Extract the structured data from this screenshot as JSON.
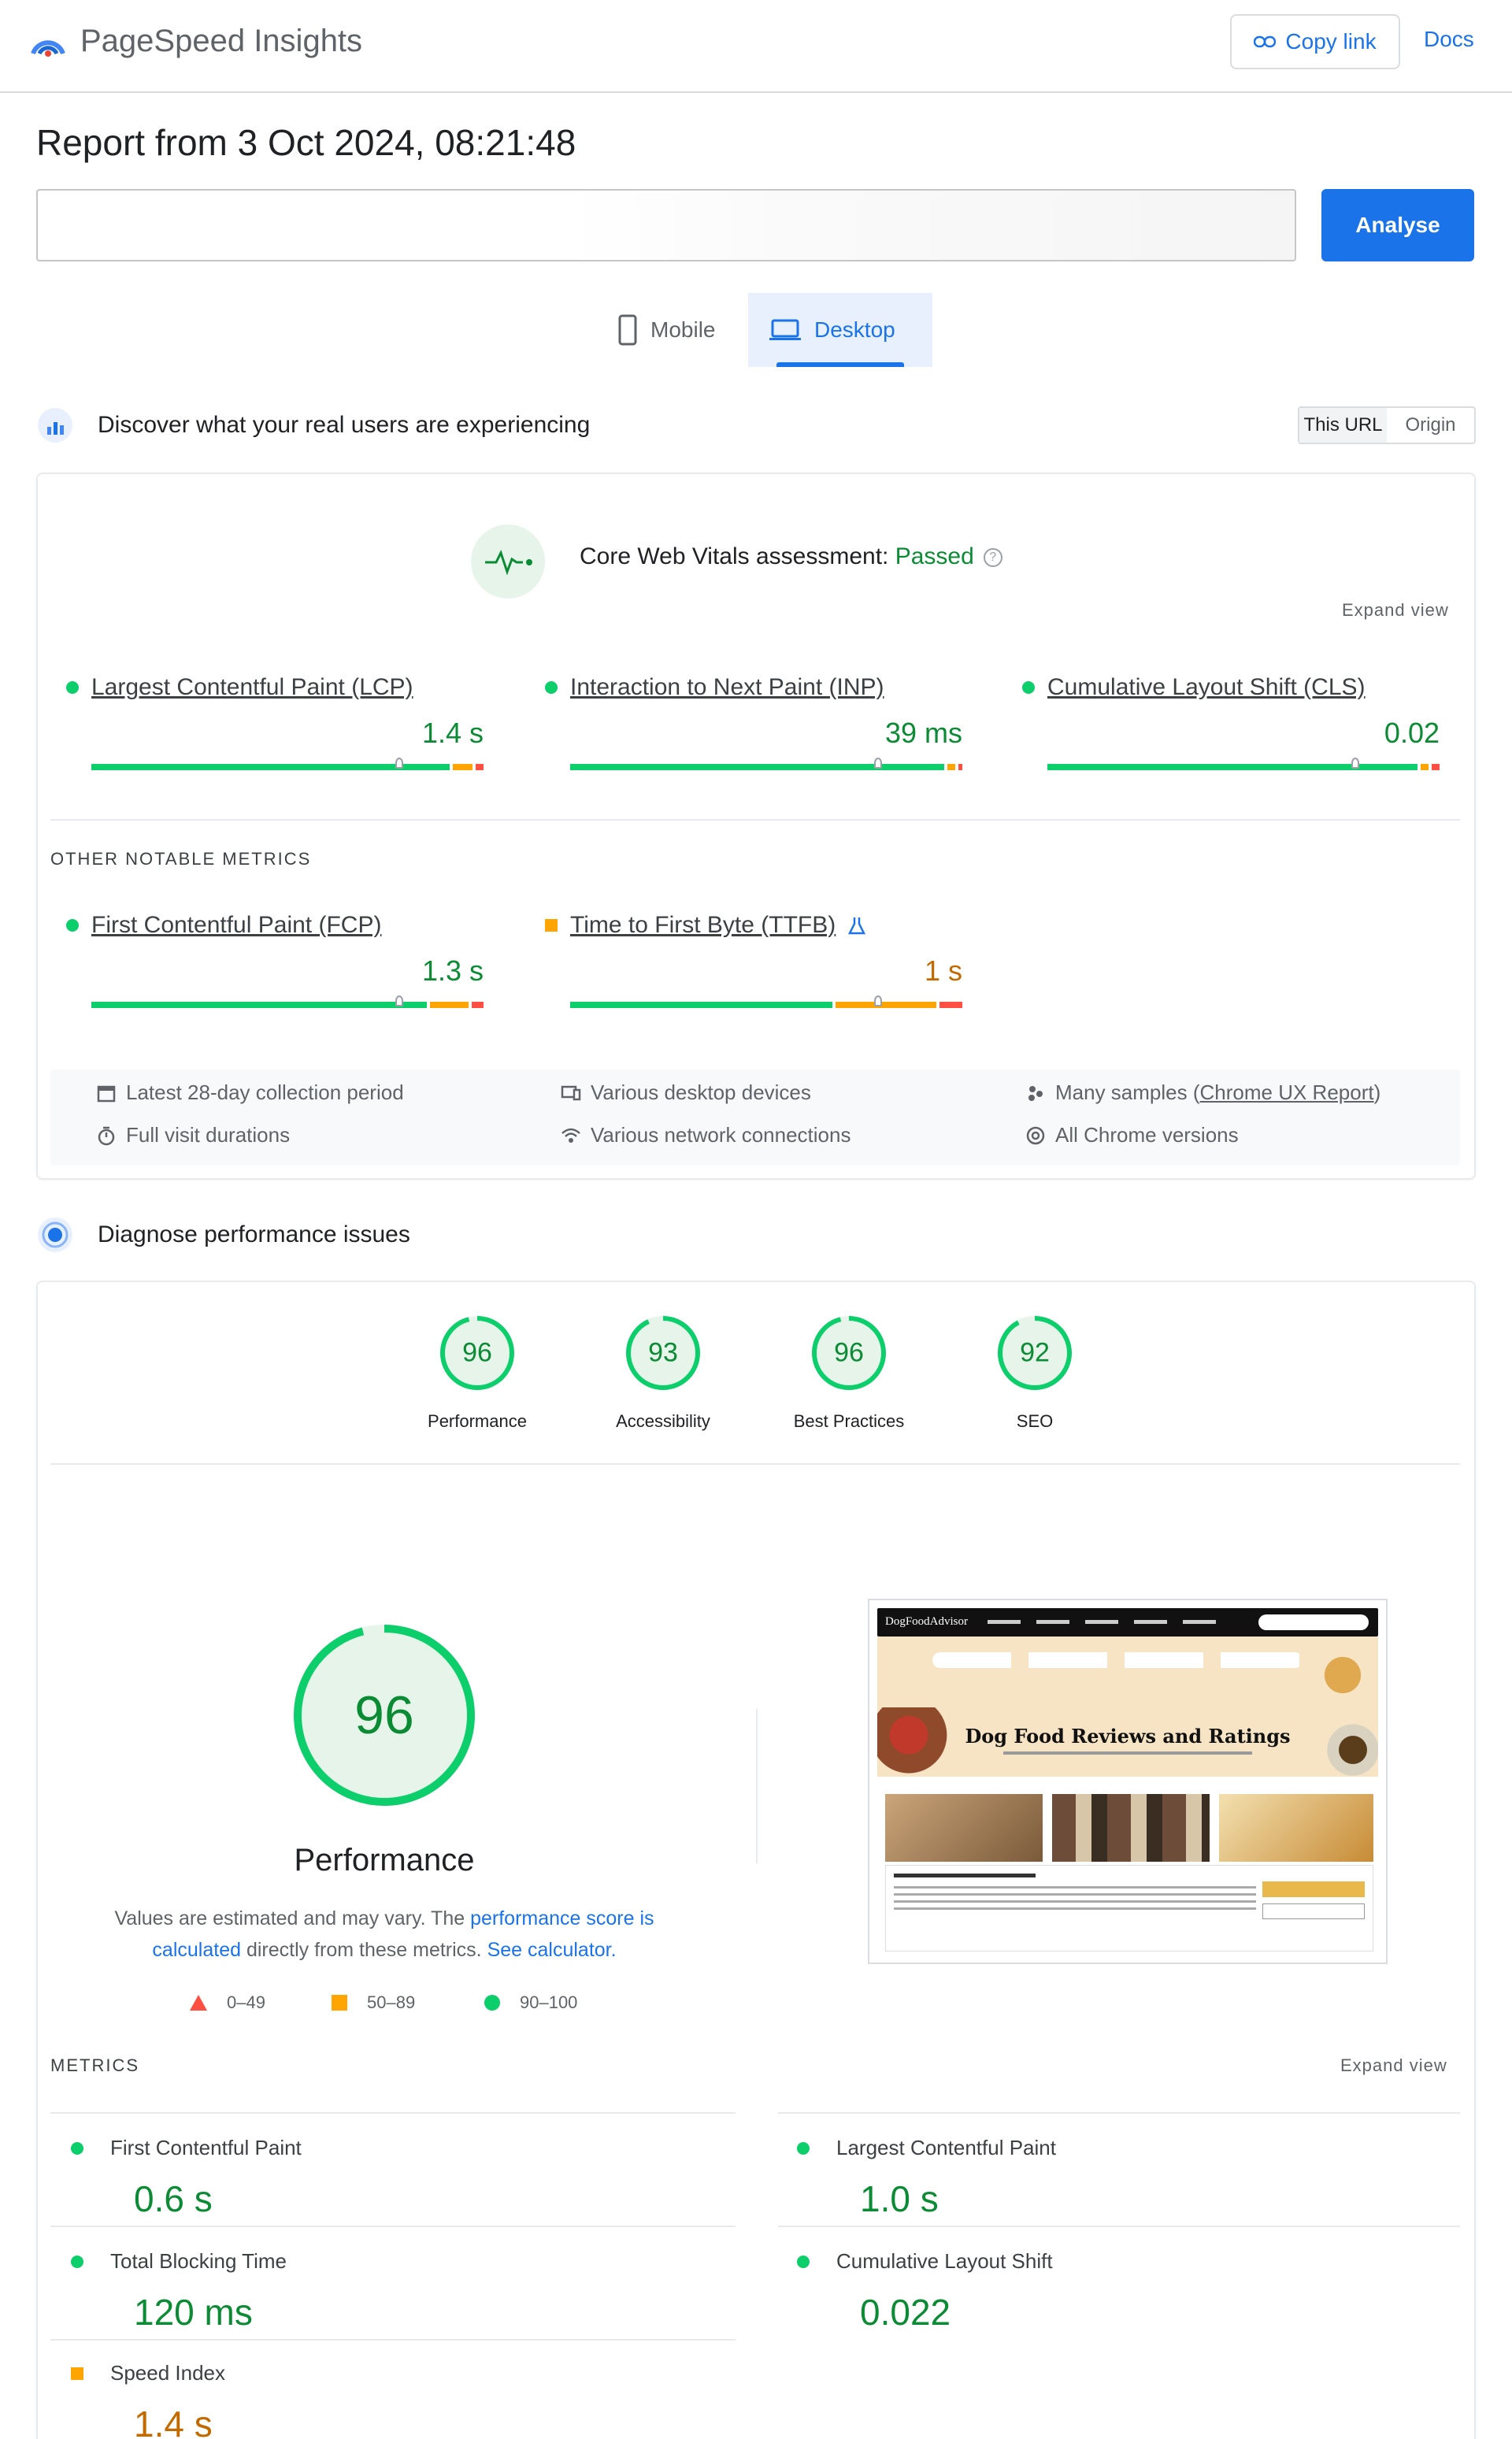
{
  "header": {
    "brand": "PageSpeed Insights",
    "copy_link": "Copy link",
    "docs": "Docs"
  },
  "report": {
    "title": "Report from 3 Oct 2024, 08:21:48",
    "url_value": "",
    "analyse": "Analyse"
  },
  "device_tabs": {
    "mobile": "Mobile",
    "desktop": "Desktop",
    "active": "desktop"
  },
  "field": {
    "heading": "Discover what your real users are experiencing",
    "toggle": [
      "This URL",
      "Origin"
    ],
    "toggle_active": "This URL",
    "assessment_label": "Core Web Vitals assessment: ",
    "assessment_result": "Passed",
    "expand_view": "Expand view",
    "core_metrics": [
      {
        "name": "Largest Contentful Paint (LCP)",
        "value": "1.4 s",
        "status": "good"
      },
      {
        "name": "Interaction to Next Paint (INP)",
        "value": "39 ms",
        "status": "good"
      },
      {
        "name": "Cumulative Layout Shift (CLS)",
        "value": "0.02",
        "status": "good"
      }
    ],
    "other_label": "OTHER NOTABLE METRICS",
    "other_metrics": [
      {
        "name": "First Contentful Paint (FCP)",
        "value": "1.3 s",
        "status": "good"
      },
      {
        "name": "Time to First Byte (TTFB)",
        "value": "1 s",
        "status": "average"
      }
    ],
    "info": {
      "period": "Latest 28-day collection period",
      "durations": "Full visit durations",
      "devices": "Various desktop devices",
      "network": "Various network connections",
      "samples_prefix": "Many samples (",
      "samples_link": "Chrome UX Report",
      "samples_suffix": ")",
      "versions": "All Chrome versions"
    }
  },
  "lab": {
    "heading": "Diagnose performance issues",
    "scores": [
      {
        "label": "Performance",
        "value": "96"
      },
      {
        "label": "Accessibility",
        "value": "93"
      },
      {
        "label": "Best Practices",
        "value": "96"
      },
      {
        "label": "SEO",
        "value": "92"
      }
    ],
    "main_score": "96",
    "main_label": "Performance",
    "desc_1": "Values are estimated and may vary. The ",
    "desc_link_1": "performance score is calculated",
    "desc_2": " directly from these metrics. ",
    "desc_link_2": "See calculator.",
    "legend": [
      "0–49",
      "50–89",
      "90–100"
    ],
    "metrics_label": "METRICS",
    "expand_view": "Expand view",
    "metrics": [
      {
        "name": "First Contentful Paint",
        "value": "0.6 s",
        "status": "good"
      },
      {
        "name": "Largest Contentful Paint",
        "value": "1.0 s",
        "status": "good"
      },
      {
        "name": "Total Blocking Time",
        "value": "120 ms",
        "status": "good"
      },
      {
        "name": "Cumulative Layout Shift",
        "value": "0.022",
        "status": "good"
      },
      {
        "name": "Speed Index",
        "value": "1.4 s",
        "status": "average"
      }
    ],
    "screenshot": {
      "site_name": "DogFoodAdvisor",
      "hero_title": "Dog Food Reviews and Ratings"
    }
  },
  "colors": {
    "accent": "#1a73e8",
    "good": "#0cce6b",
    "good_text": "#0c8b35",
    "average": "#ffa400",
    "poor": "#ff4e42"
  }
}
